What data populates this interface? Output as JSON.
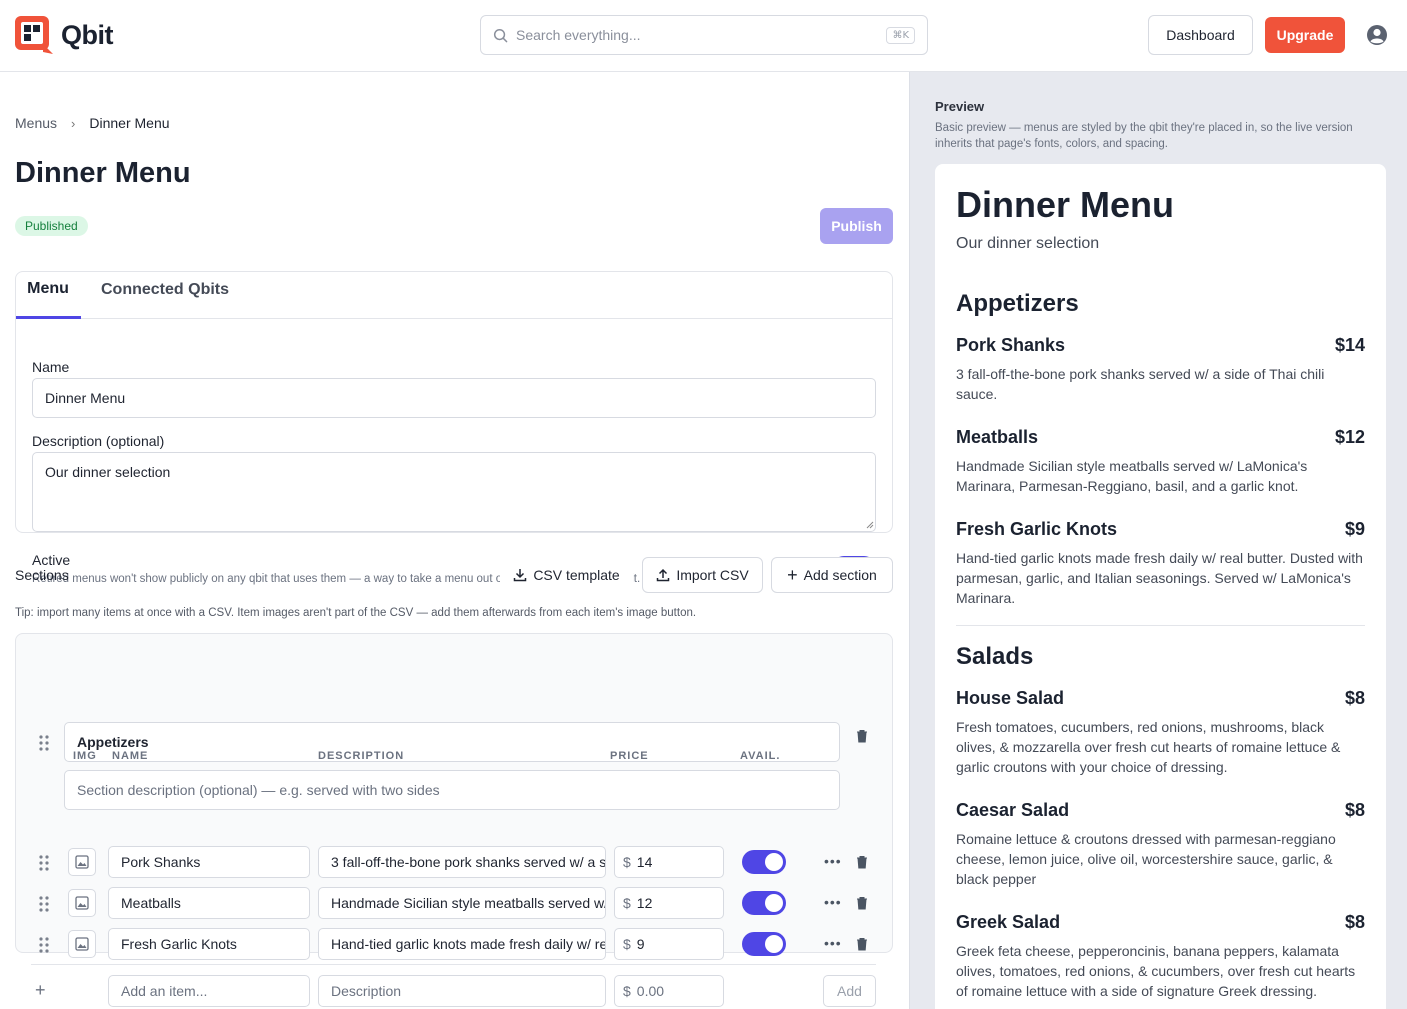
{
  "header": {
    "logo_text": "Qbit",
    "search_placeholder": "Search everything...",
    "search_kbd": "⌘K",
    "dashboard_label": "Dashboard",
    "upgrade_label": "Upgrade"
  },
  "breadcrumb": {
    "parent": "Menus",
    "current": "Dinner Menu"
  },
  "page": {
    "title": "Dinner Menu",
    "status": "Published",
    "publish_label": "Publish",
    "tabs": [
      "Menu",
      "Connected Qbits"
    ]
  },
  "form": {
    "name_label": "Name",
    "name_value": "Dinner Menu",
    "desc_label": "Description (optional)",
    "desc_value": "Our dinner selection",
    "active_label": "Active",
    "active_help": "Retired menus won't show publicly on any qbit that uses them — a way to take a menu out of service without deleting it.",
    "active": true
  },
  "sections": {
    "title": "Sections",
    "csv_template": "CSV template",
    "import_csv": "Import CSV",
    "add_section": "Add section",
    "tip": "Tip: import many items at once with a CSV. Item images aren't part of the CSV — add them afterwards from each item's image button.",
    "section_name": "Appetizers",
    "section_desc_placeholder": "Section description (optional) — e.g. served with two sides",
    "columns": {
      "img": "IMG",
      "name": "NAME",
      "description": "DESCRIPTION",
      "price": "PRICE",
      "avail": "AVAIL."
    },
    "items": [
      {
        "name": "Pork Shanks",
        "description": "3 fall-off-the-bone pork shanks served w/ a side of Thai chili sauce.",
        "price": "14",
        "available": true
      },
      {
        "name": "Meatballs",
        "description": "Handmade Sicilian style meatballs served w/ LaMonica's Marinara, Parmesan-Reggiano, basil, and a garlic knot.",
        "price": "12",
        "available": true
      },
      {
        "name": "Fresh Garlic Knots",
        "description": "Hand-tied garlic knots made fresh daily w/ real butter.",
        "price": "9",
        "available": true
      }
    ],
    "currency": "$",
    "new_item_placeholder": "Add an item...",
    "new_desc_placeholder": "Description",
    "new_price_placeholder": "0.00",
    "add_label": "Add"
  },
  "preview": {
    "label": "Preview",
    "note": "Basic preview — menus are styled by the qbit they're placed in, so the live version inherits that page's fonts, colors, and spacing.",
    "title": "Dinner Menu",
    "description": "Our dinner selection",
    "sections": [
      {
        "name": "Appetizers",
        "items": [
          {
            "name": "Pork Shanks",
            "price": "$14",
            "description": "3 fall-off-the-bone pork shanks served w/ a side of Thai chili sauce."
          },
          {
            "name": "Meatballs",
            "price": "$12",
            "description": "Handmade Sicilian style meatballs served w/ LaMonica's Marinara, Parmesan-Reggiano, basil, and a garlic knot."
          },
          {
            "name": "Fresh Garlic Knots",
            "price": "$9",
            "description": "Hand-tied garlic knots made fresh daily w/ real butter. Dusted with parmesan, garlic, and Italian seasonings. Served w/ LaMonica's Marinara."
          }
        ]
      },
      {
        "name": "Salads",
        "items": [
          {
            "name": "House Salad",
            "price": "$8",
            "description": "Fresh tomatoes, cucumbers, red onions, mushrooms, black olives, & mozzarella over fresh cut hearts of romaine lettuce & garlic croutons with your choice of dressing."
          },
          {
            "name": "Caesar Salad",
            "price": "$8",
            "description": "Romaine lettuce & croutons dressed with parmesan-reggiano cheese, lemon juice, olive oil, worcestershire sauce, garlic, & black pepper"
          },
          {
            "name": "Greek Salad",
            "price": "$8",
            "description": "Greek feta cheese, pepperoncinis, banana peppers, kalamata olives, tomatoes, red onions, & cucumbers, over fresh cut hearts of romaine lettuce with a side of signature Greek dressing."
          }
        ]
      }
    ]
  }
}
